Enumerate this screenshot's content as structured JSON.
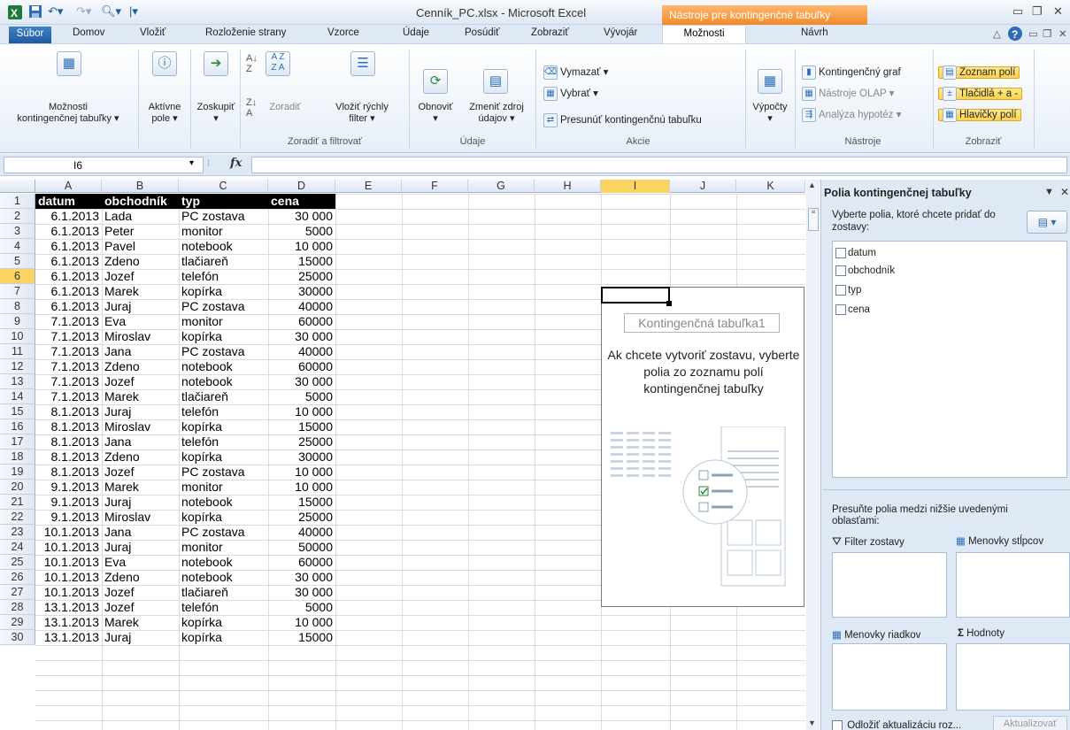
{
  "window": {
    "title": "Cenník_PC.xlsx - Microsoft Excel",
    "context_header": "Nástroje pre kontingenčné tabuľky"
  },
  "tabs": {
    "file": "Súbor",
    "items": [
      "Domov",
      "Vložiť",
      "Rozloženie strany",
      "Vzorce",
      "Údaje",
      "Posúdiť",
      "Zobraziť",
      "Vývojár"
    ],
    "options": "Možnosti",
    "design": "Návrh"
  },
  "ribbon": {
    "btn_options": "Možnosti\nkontingenčnej tabuľky ▾",
    "btn_active_field": "Aktívne\npole ▾",
    "btn_group": "Zoskupiť\n▾",
    "btn_sort": "Zoradiť",
    "btn_slicer": "Vložiť rýchly\nfilter ▾",
    "btn_refresh": "Obnoviť\n▾",
    "btn_change_source": "Zmeniť zdroj\núdajov ▾",
    "grp_sort": "Zoradiť a filtrovať",
    "grp_data": "Údaje",
    "act_clear": "Vymazať ▾",
    "act_select": "Vybrať ▾",
    "act_move": "Presunúť kontingenčnú tabuľku",
    "grp_actions": "Akcie",
    "btn_calc": "Výpočty\n▾",
    "tool_chart": "Kontingenčný graf",
    "tool_olap": "Nástroje OLAP ▾",
    "tool_whatif": "Analýza hypotéz ▾",
    "grp_tools": "Nástroje",
    "show_fieldlist": "Zoznam polí",
    "show_buttons": "Tlačidlá + a -",
    "show_headers": "Hlavičky polí",
    "grp_show": "Zobraziť"
  },
  "formula": {
    "namebox": "I6",
    "fx": "fx",
    "value": ""
  },
  "columns": [
    "A",
    "B",
    "C",
    "D",
    "E",
    "F",
    "G",
    "H",
    "I",
    "J",
    "K"
  ],
  "rows": [
    "1",
    "2",
    "3",
    "4",
    "5",
    "6",
    "7",
    "8",
    "9",
    "10",
    "11",
    "12",
    "13",
    "14",
    "15",
    "16",
    "17",
    "18",
    "19",
    "20",
    "21",
    "22",
    "23",
    "24",
    "25",
    "26",
    "27",
    "28",
    "29",
    "30"
  ],
  "sheet": {
    "header": [
      "datum",
      "obchodník",
      "typ",
      "cena"
    ],
    "data": [
      [
        "6.1.2013",
        "Lada",
        "PC zostava",
        "30 000"
      ],
      [
        "6.1.2013",
        "Peter",
        "monitor",
        "5000"
      ],
      [
        "6.1.2013",
        "Pavel",
        "notebook",
        "10 000"
      ],
      [
        "6.1.2013",
        "Zdeno",
        "tlačiareň",
        "15000"
      ],
      [
        "6.1.2013",
        "Jozef",
        "telefón",
        "25000"
      ],
      [
        "6.1.2013",
        "Marek",
        "kopírka",
        "30000"
      ],
      [
        "6.1.2013",
        "Juraj",
        "PC zostava",
        "40000"
      ],
      [
        "7.1.2013",
        "Eva",
        "monitor",
        "60000"
      ],
      [
        "7.1.2013",
        "Miroslav",
        "kopírka",
        "30 000"
      ],
      [
        "7.1.2013",
        "Jana",
        "PC zostava",
        "40000"
      ],
      [
        "7.1.2013",
        "Zdeno",
        "notebook",
        "60000"
      ],
      [
        "7.1.2013",
        "Jozef",
        "notebook",
        "30 000"
      ],
      [
        "7.1.2013",
        "Marek",
        "tlačiareň",
        "5000"
      ],
      [
        "8.1.2013",
        "Juraj",
        "telefón",
        "10 000"
      ],
      [
        "8.1.2013",
        "Miroslav",
        "kopírka",
        "15000"
      ],
      [
        "8.1.2013",
        "Jana",
        "telefón",
        "25000"
      ],
      [
        "8.1.2013",
        "Zdeno",
        "kopírka",
        "30000"
      ],
      [
        "8.1.2013",
        "Jozef",
        "PC zostava",
        "10 000"
      ],
      [
        "9.1.2013",
        "Marek",
        "monitor",
        "10 000"
      ],
      [
        "9.1.2013",
        "Juraj",
        "notebook",
        "15000"
      ],
      [
        "9.1.2013",
        "Miroslav",
        "kopírka",
        "25000"
      ],
      [
        "10.1.2013",
        "Jana",
        "PC zostava",
        "40000"
      ],
      [
        "10.1.2013",
        "Juraj",
        "monitor",
        "50000"
      ],
      [
        "10.1.2013",
        "Eva",
        "notebook",
        "60000"
      ],
      [
        "10.1.2013",
        "Zdeno",
        "notebook",
        "30 000"
      ],
      [
        "10.1.2013",
        "Jozef",
        "tlačiareň",
        "30 000"
      ],
      [
        "13.1.2013",
        "Jozef",
        "telefón",
        "5000"
      ],
      [
        "13.1.2013",
        "Marek",
        "kopírka",
        "10 000"
      ],
      [
        "13.1.2013",
        "Juraj",
        "kopírka",
        "15000"
      ]
    ]
  },
  "pivot": {
    "name": "Kontingenčná tabuľka1",
    "hint": "Ak chcete vytvoriť zostavu, vyberte polia zo zoznamu polí kontingenčnej tabuľky"
  },
  "pane": {
    "title": "Polia kontingenčnej tabuľky",
    "choose": "Vyberte polia, ktoré chcete pridať do zostavy:",
    "fields": [
      "datum",
      "obchodník",
      "typ",
      "cena"
    ],
    "move_hint": "Presuňte polia medzi nižšie uvedenými oblasťami:",
    "area_filter": "Filter zostavy",
    "area_columns": "Menovky stĺpcov",
    "area_rows": "Menovky riadkov",
    "area_values": "Hodnoty",
    "defer": "Odložiť aktualizáciu roz...",
    "update": "Aktualizovať"
  }
}
